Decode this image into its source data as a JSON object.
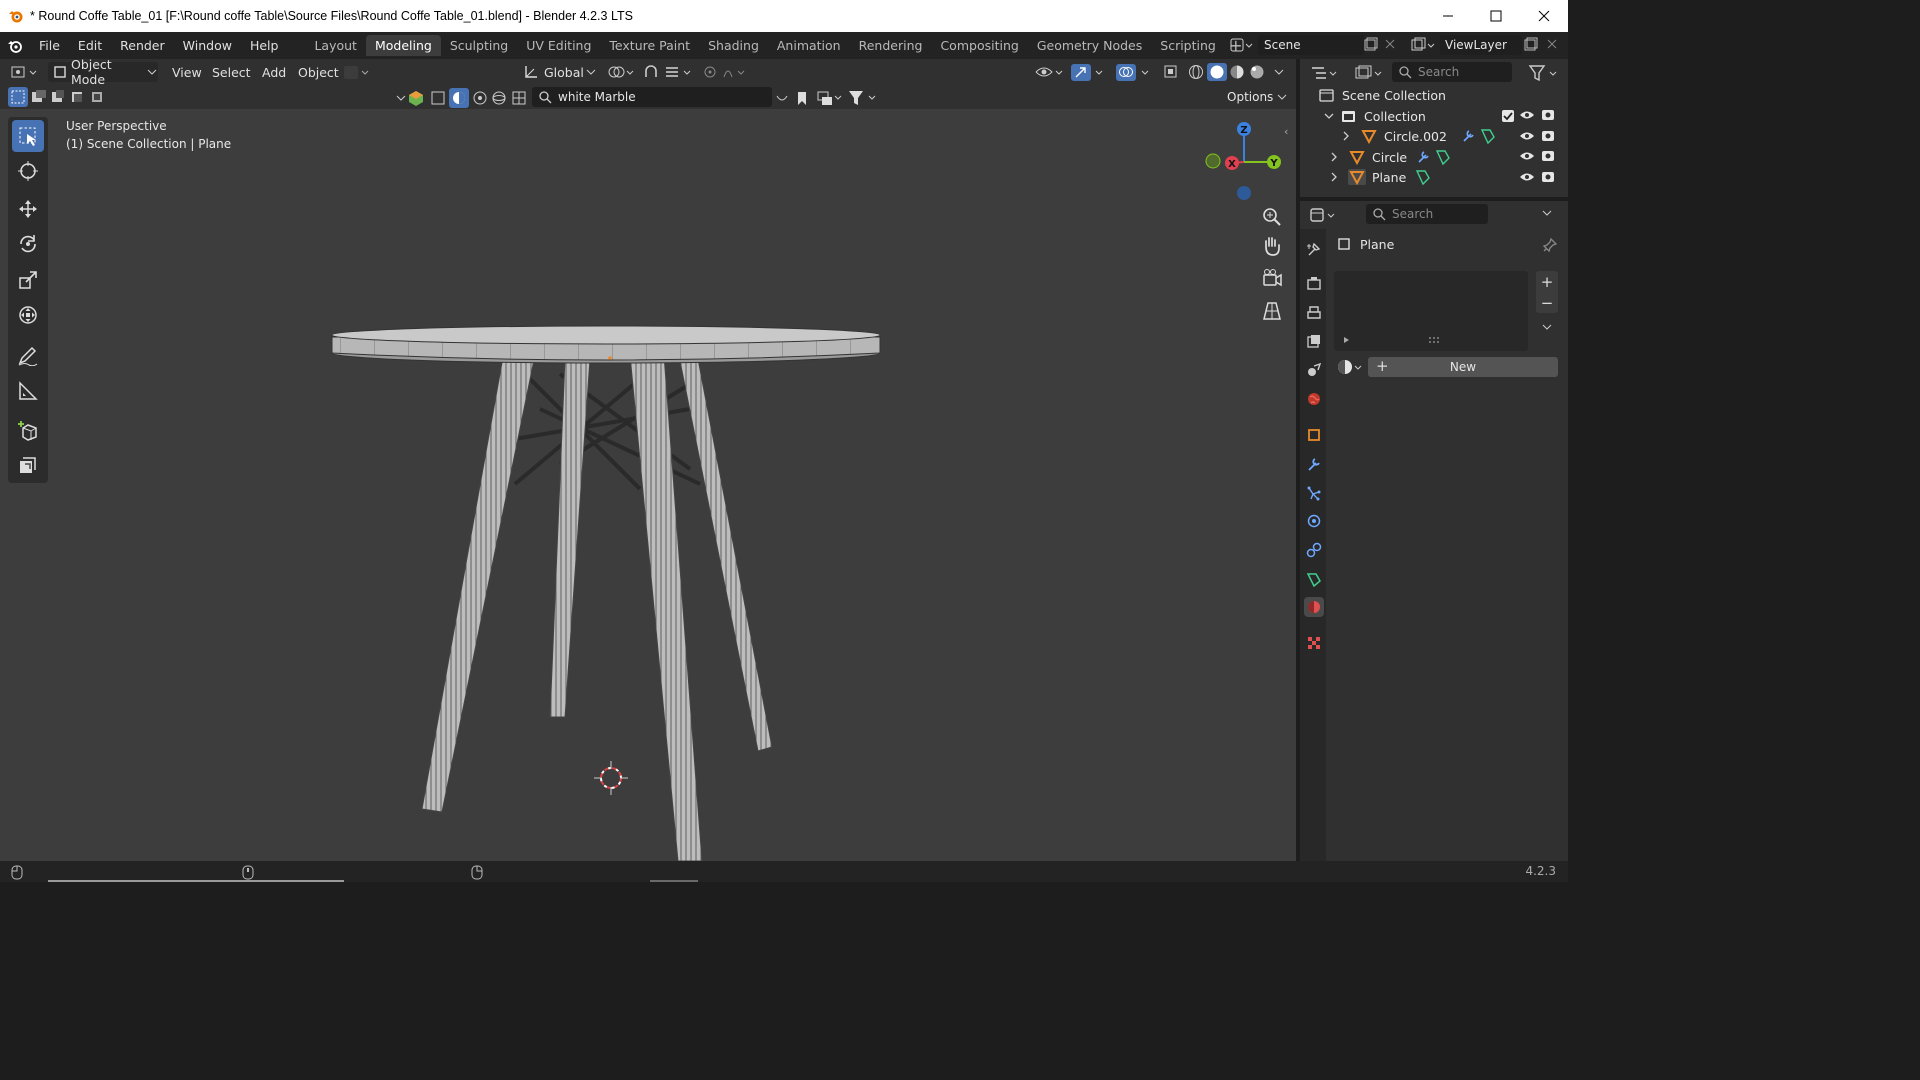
{
  "window": {
    "title": "* Round Coffe Table_01 [F:\\Round coffe Table\\Source Files\\Round Coffe Table_01.blend] - Blender 4.2.3 LTS",
    "controls": [
      "minimize-icon",
      "maximize-icon",
      "close-icon"
    ]
  },
  "menu": [
    "File",
    "Edit",
    "Render",
    "Window",
    "Help"
  ],
  "workspaces": [
    {
      "label": "Layout",
      "active": false
    },
    {
      "label": "Modeling",
      "active": true
    },
    {
      "label": "Sculpting",
      "active": false
    },
    {
      "label": "UV Editing",
      "active": false
    },
    {
      "label": "Texture Paint",
      "active": false
    },
    {
      "label": "Shading",
      "active": false
    },
    {
      "label": "Animation",
      "active": false
    },
    {
      "label": "Rendering",
      "active": false
    },
    {
      "label": "Compositing",
      "active": false
    },
    {
      "label": "Geometry Nodes",
      "active": false
    },
    {
      "label": "Scripting",
      "active": false
    }
  ],
  "scene": {
    "name": "Scene",
    "view_layer": "ViewLayer"
  },
  "viewport_header": {
    "mode": "Object Mode",
    "menus": [
      "View",
      "Select",
      "Add",
      "Object"
    ],
    "orientation": "Global",
    "material_search": "white Marble",
    "options_label": "Options"
  },
  "viewport": {
    "perspective": "User Perspective",
    "collection_info": "(1) Scene Collection | Plane",
    "gizmo_axes": [
      "Z",
      "X",
      "Y"
    ]
  },
  "outliner": {
    "search_placeholder": "Search",
    "root": "Scene Collection",
    "collection": "Collection",
    "items": [
      {
        "name": "Circle.002",
        "icons": [
          "wrench-icon",
          "mesh-data-icon"
        ]
      },
      {
        "name": "Circle",
        "icons": [
          "wrench-icon",
          "mesh-data-icon"
        ]
      },
      {
        "name": "Plane",
        "icons": [
          "mesh-data-icon"
        ]
      }
    ]
  },
  "properties": {
    "search_placeholder": "Search",
    "object_name": "Plane",
    "new_button": "New"
  },
  "statusbar": {
    "version": "4.2.3"
  },
  "colors": {
    "accent": "#4772b3",
    "axis_x": "#e0404f",
    "axis_y": "#83c41f",
    "axis_z": "#3b82e0",
    "orange": "#e8892a"
  }
}
